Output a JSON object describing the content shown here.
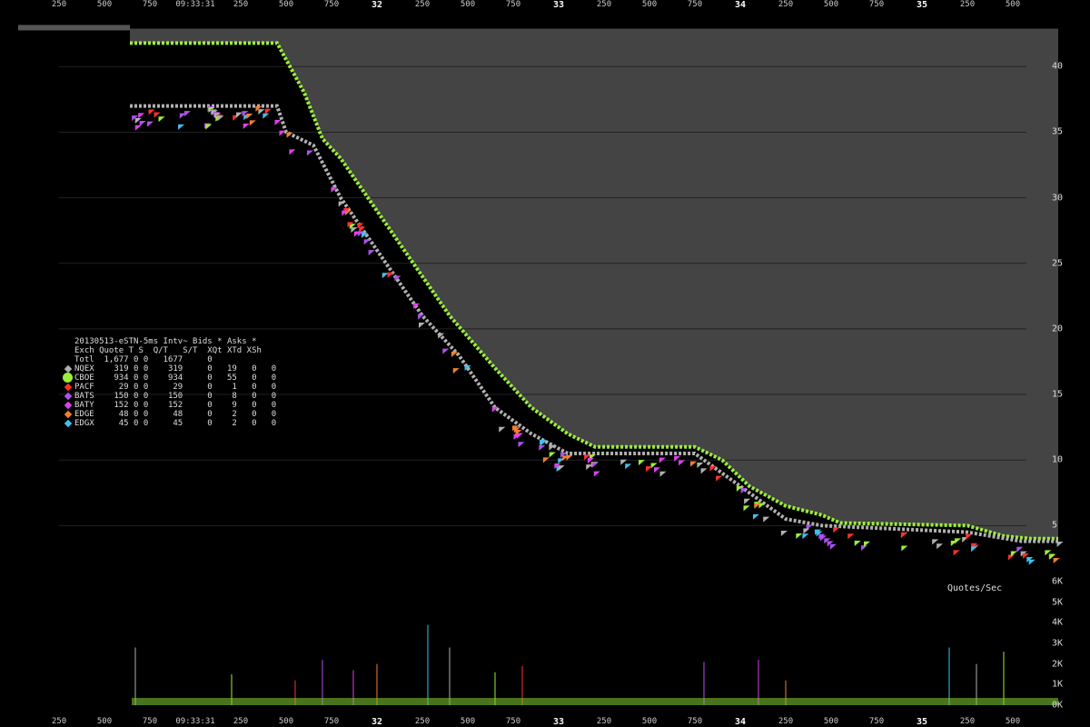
{
  "chart_data": {
    "type": "scatter",
    "title": "20130513-eSTN-5ms Intv~ Bids * Asks *",
    "time_label": "09:33:31",
    "x_ticks": [
      "250",
      "500",
      "750",
      "09:33:31",
      "250",
      "500",
      "750",
      "32",
      "250",
      "500",
      "750",
      "33",
      "250",
      "500",
      "750",
      "34",
      "250",
      "500",
      "750",
      "35",
      "250",
      "500"
    ],
    "x_major": [
      "32",
      "33",
      "34",
      "35"
    ],
    "ylim": [
      3.5,
      43
    ],
    "y_ticks": [
      5,
      10,
      15,
      20,
      25,
      30,
      35,
      40
    ],
    "volume_label": "Quotes/Sec",
    "volume_ticks": [
      "0K",
      "1K",
      "2K",
      "3K",
      "4K",
      "5K",
      "6K"
    ],
    "volume_ylim": [
      0,
      6000
    ],
    "ask_envelope": [
      [
        0.39,
        41.8
      ],
      [
        1.2,
        41.8
      ],
      [
        1.35,
        38
      ],
      [
        1.45,
        34.5
      ],
      [
        1.55,
        33
      ],
      [
        1.7,
        30
      ],
      [
        1.9,
        26
      ],
      [
        2.15,
        21
      ],
      [
        2.4,
        17
      ],
      [
        2.6,
        14
      ],
      [
        2.8,
        12
      ],
      [
        2.95,
        11
      ],
      [
        3.5,
        11
      ],
      [
        3.65,
        10
      ],
      [
        3.8,
        8
      ],
      [
        4.0,
        6.5
      ],
      [
        4.2,
        5.8
      ],
      [
        4.3,
        5.2
      ],
      [
        5.0,
        5.0
      ],
      [
        5.2,
        4.2
      ],
      [
        5.35,
        4.0
      ],
      [
        5.5,
        4.0
      ]
    ],
    "bid_envelope": [
      [
        0.39,
        37
      ],
      [
        1.2,
        37
      ],
      [
        1.25,
        35
      ],
      [
        1.4,
        34
      ],
      [
        1.55,
        30
      ],
      [
        1.7,
        27
      ],
      [
        1.85,
        24
      ],
      [
        2.0,
        21
      ],
      [
        2.2,
        18
      ],
      [
        2.4,
        14
      ],
      [
        2.6,
        12
      ],
      [
        2.8,
        10.5
      ],
      [
        3.5,
        10.5
      ],
      [
        3.65,
        9
      ],
      [
        3.85,
        7
      ],
      [
        4.0,
        5.5
      ],
      [
        4.2,
        5.0
      ],
      [
        5.0,
        4.5
      ],
      [
        5.3,
        3.8
      ],
      [
        5.5,
        3.8
      ]
    ],
    "volume_spikes": [
      [
        0.42,
        2800
      ],
      [
        0.95,
        1500
      ],
      [
        1.3,
        1200
      ],
      [
        1.45,
        2200
      ],
      [
        1.62,
        1700
      ],
      [
        1.75,
        2000
      ],
      [
        2.03,
        3900
      ],
      [
        2.15,
        2800
      ],
      [
        2.4,
        1600
      ],
      [
        2.55,
        1900
      ],
      [
        3.55,
        2100
      ],
      [
        3.85,
        2200
      ],
      [
        4.0,
        1200
      ],
      [
        4.9,
        2800
      ],
      [
        5.05,
        2000
      ],
      [
        5.2,
        2600
      ]
    ],
    "series": [
      {
        "name": "Totl",
        "quote": "1,677",
        "t": "0",
        "s": "0",
        "qt": "1677",
        "st": "0",
        "xqt": "",
        "xtd": "",
        "xsh": ""
      },
      {
        "name": "NQEX",
        "quote": "319",
        "t": "0",
        "s": "0",
        "qt": "319",
        "st": "0",
        "xqt": "19",
        "xtd": "0",
        "xsh": "0",
        "color": "#b0b0b0"
      },
      {
        "name": "CBOE",
        "quote": "934",
        "t": "0",
        "s": "0",
        "qt": "934",
        "st": "0",
        "xqt": "55",
        "xtd": "0",
        "xsh": "0",
        "color": "#9aee3a"
      },
      {
        "name": "PACF",
        "quote": "29",
        "t": "0",
        "s": "0",
        "qt": "29",
        "st": "0",
        "xqt": "1",
        "xtd": "0",
        "xsh": "0",
        "color": "#ff3030"
      },
      {
        "name": "BATS",
        "quote": "150",
        "t": "0",
        "s": "0",
        "qt": "150",
        "st": "0",
        "xqt": "8",
        "xtd": "0",
        "xsh": "0",
        "color": "#b050f0"
      },
      {
        "name": "BATY",
        "quote": "152",
        "t": "0",
        "s": "0",
        "qt": "152",
        "st": "0",
        "xqt": "9",
        "xtd": "0",
        "xsh": "0",
        "color": "#e040f0"
      },
      {
        "name": "EDGE",
        "quote": "48",
        "t": "0",
        "s": "0",
        "qt": "48",
        "st": "0",
        "xqt": "2",
        "xtd": "0",
        "xsh": "0",
        "color": "#f08030"
      },
      {
        "name": "EDGX",
        "quote": "45",
        "t": "0",
        "s": "0",
        "qt": "45",
        "st": "0",
        "xqt": "2",
        "xtd": "0",
        "xsh": "0",
        "color": "#40c0f0"
      }
    ],
    "legend_header": "Exch Quote T S  Q/T   S/T  XQt XTd XSh"
  }
}
